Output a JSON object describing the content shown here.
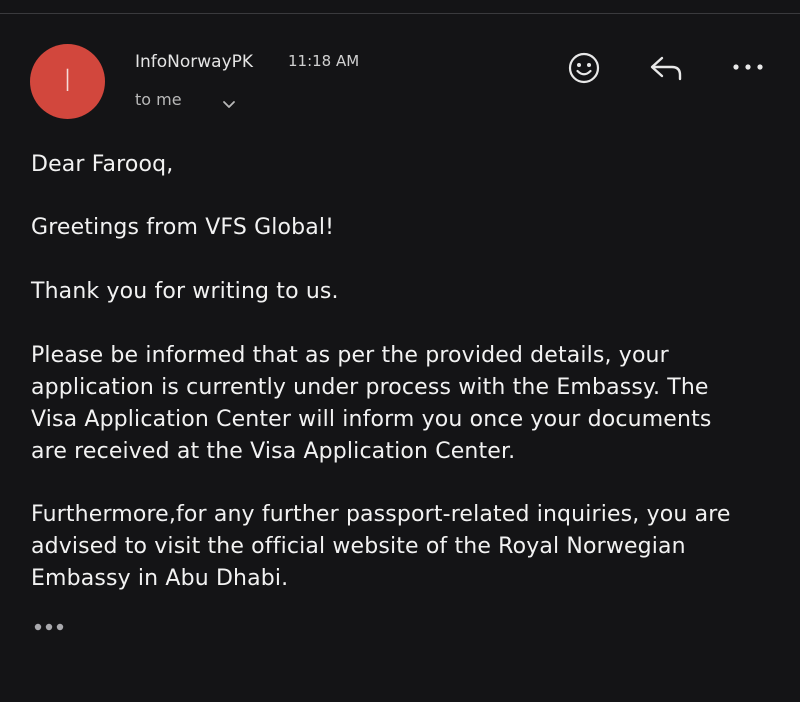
{
  "header": {
    "avatar_letter": "I",
    "avatar_color": "#d2473d",
    "sender_name": "InfoNorwayPK",
    "time": "11:18 AM",
    "recipient": "to me",
    "recipient_chevron_icon": "chevron-down-icon",
    "actions": {
      "emoji_icon": "smiley-icon",
      "reply_icon": "reply-icon",
      "more_icon": "more-horizontal-icon"
    }
  },
  "message": {
    "greeting": "Dear Farooq,",
    "hello": "Greetings from VFS Global!",
    "thanks": "Thank you for writing to us.",
    "info_lines": [
      "Please be informed that as per the provided details, your",
      "application is currently under process with the Embassy. The",
      "Visa Application Center will inform you once your documents",
      "are received at the Visa Application Center."
    ],
    "further_lines": [
      "Furthermore,for any further passport-related inquiries, you are",
      "advised to visit the official website of the Royal Norwegian",
      "Embassy in Abu Dhabi."
    ],
    "trimmed_content_icon": "ellipsis-icon"
  },
  "colors": {
    "background": "#141416",
    "text": "#f2f2f2",
    "secondary_text": "#b8b8b8"
  }
}
